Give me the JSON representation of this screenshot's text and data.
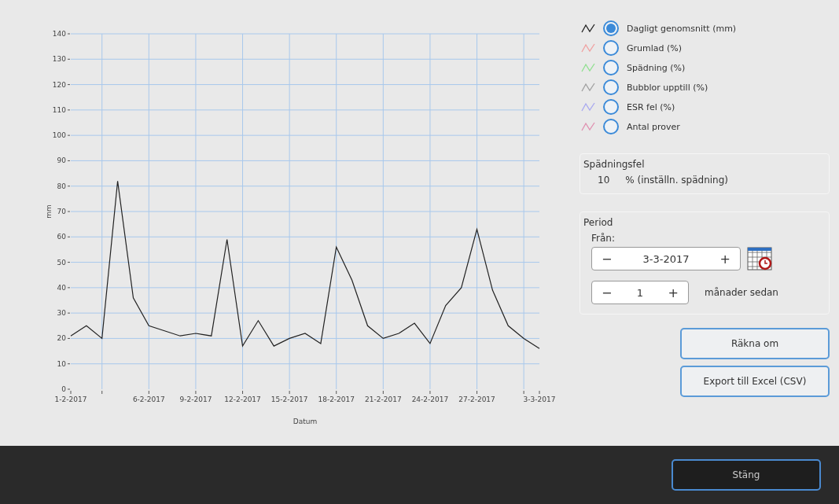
{
  "chart": {
    "chart_data": {
      "type": "line",
      "xlabel": "Datum",
      "ylabel": "mm",
      "categories": [
        "1-2-2017",
        null,
        null,
        null,
        null,
        "6-2-2017",
        null,
        null,
        "9-2-2017",
        null,
        null,
        "12-2-2017",
        null,
        null,
        "15-2-2017",
        null,
        null,
        "18-2-2017",
        null,
        null,
        "21-2-2017",
        null,
        null,
        "24-2-2017",
        null,
        null,
        "27-2-2017",
        null,
        null,
        null,
        "3-3-2017"
      ],
      "series": [
        {
          "color": "#222222",
          "values": [
            21,
            25,
            20,
            82,
            36,
            25,
            23,
            21,
            22,
            21,
            59,
            17,
            27,
            17,
            20,
            22,
            18,
            56,
            43,
            25,
            20,
            22,
            26,
            18,
            33,
            40,
            63,
            39,
            25,
            20,
            16
          ]
        }
      ],
      "ylim": [
        0,
        140
      ],
      "grid": true,
      "yticks": [
        0,
        10,
        20,
        30,
        40,
        50,
        60,
        70,
        80,
        90,
        100,
        110,
        120,
        130,
        140
      ]
    }
  },
  "legend": {
    "items": [
      {
        "label": "Dagligt genomsnitt (mm)",
        "color": "#222222",
        "selected": true
      },
      {
        "label": "Grumlad (%)",
        "color": "#f0a0a0",
        "selected": false
      },
      {
        "label": "Spädning (%)",
        "color": "#90e090",
        "selected": false
      },
      {
        "label": "Bubblor upptill (%)",
        "color": "#a0a0a0",
        "selected": false
      },
      {
        "label": "ESR fel (%)",
        "color": "#a8a8f0",
        "selected": false
      },
      {
        "label": "Antal prover",
        "color": "#e090b0",
        "selected": false
      }
    ]
  },
  "dilution_error": {
    "title": "Spädningsfel",
    "value": "10",
    "unit": "% (inställn. spädning)"
  },
  "period": {
    "title": "Period",
    "from_label": "Från:",
    "date": {
      "minus": "−",
      "value": "3-3-2017",
      "plus": "+"
    },
    "months": {
      "minus": "−",
      "value": "1",
      "plus": "+"
    },
    "months_label": "månader sedan"
  },
  "buttons": [
    "Räkna om",
    "Export till Excel (CSV)"
  ],
  "footer": {
    "close_button": "Stäng"
  }
}
